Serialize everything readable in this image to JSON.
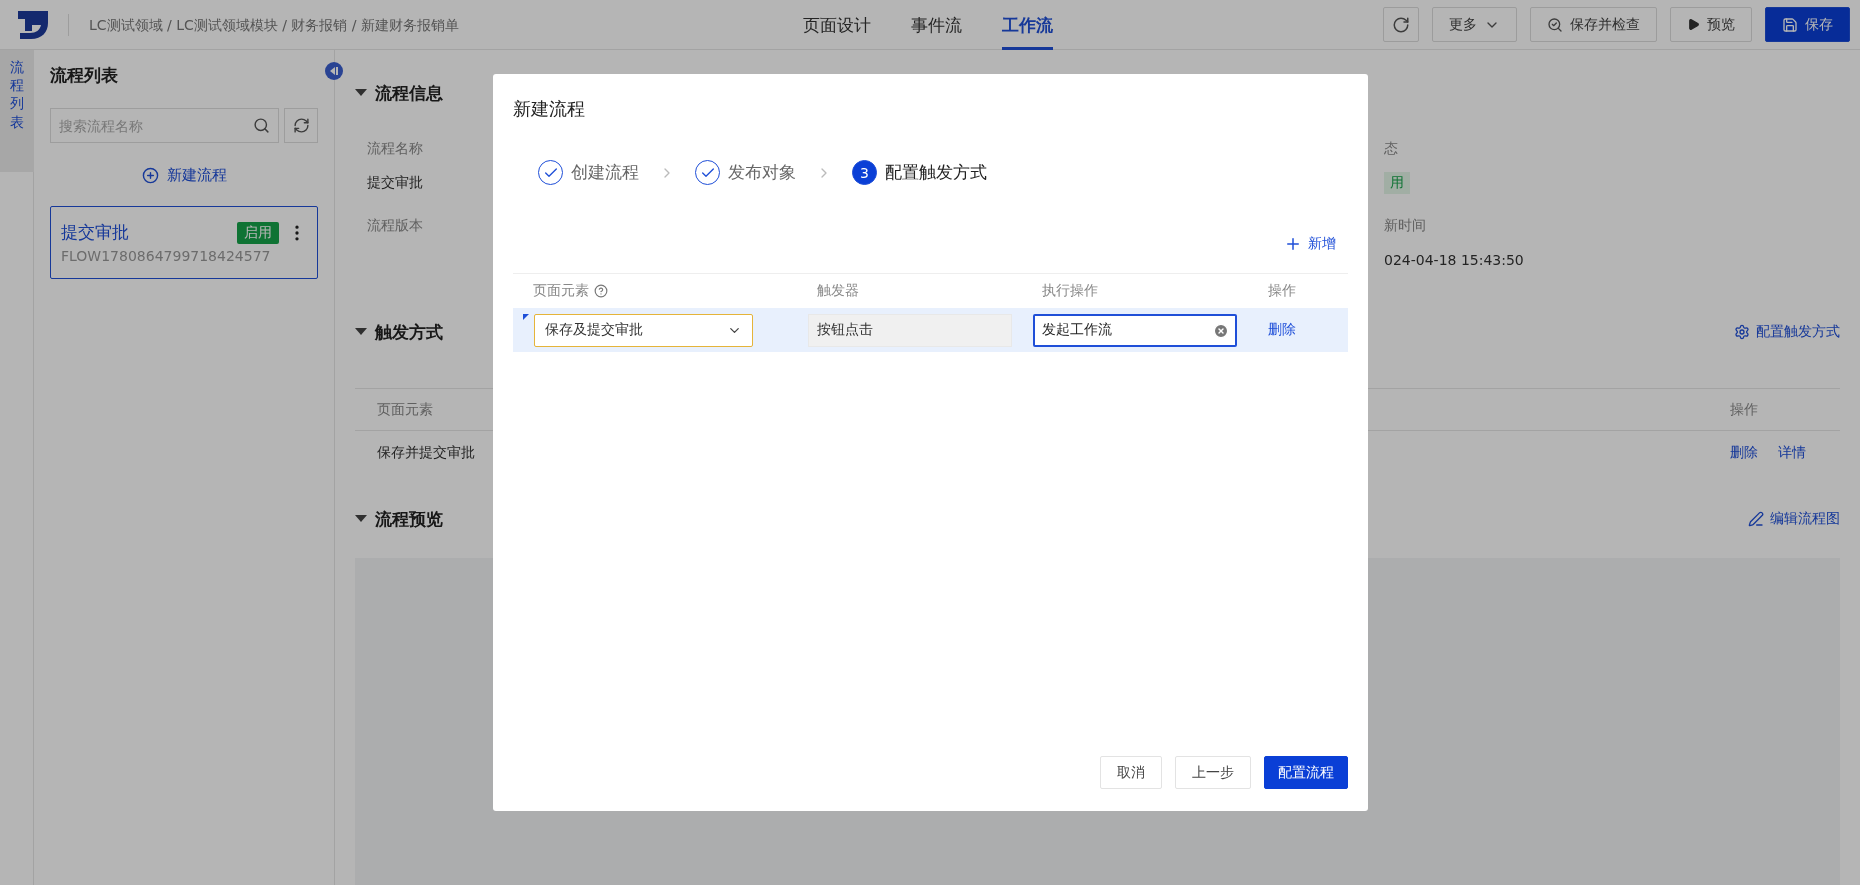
{
  "header": {
    "breadcrumb": "LC测试领域 / LC测试领域模块 / 财务报销 / 新建财务报销单",
    "tabs": [
      {
        "label": "页面设计",
        "selected": false
      },
      {
        "label": "事件流",
        "selected": false
      },
      {
        "label": "工作流",
        "selected": true
      }
    ],
    "buttons": [
      {
        "kind": "refresh"
      },
      {
        "kind": "dropdown",
        "label": "更多"
      },
      {
        "kind": "check",
        "label": "保存并检查"
      },
      {
        "kind": "play",
        "label": "预览"
      },
      {
        "kind": "save",
        "label": "保存"
      }
    ]
  },
  "side_tab": {
    "label": "流程列表",
    "selected": true
  },
  "sidebar": {
    "title": "流程列表",
    "search": {
      "placeholder": "搜索流程名称"
    },
    "new_button": "新建流程",
    "flows": [
      {
        "name": "提交审批",
        "code": "FLOW1780864799718424577",
        "status": "启用",
        "selected": true
      }
    ]
  },
  "flow_info": {
    "title": "流程信息",
    "expanded": true,
    "fields": [
      {
        "label": "流程名称",
        "value": "提交审批"
      },
      {
        "label": "流程版本"
      }
    ],
    "fields_right": [
      {
        "label": "态",
        "value": "用",
        "kind": "tag"
      },
      {
        "label": "新时间",
        "value": "024-04-18 15:43:50",
        "kind": "text"
      }
    ]
  },
  "trigger": {
    "title": "触发方式",
    "expanded": true,
    "action": "配置触发方式",
    "columns": [
      "页面元素",
      "操作"
    ],
    "rows": [
      {
        "element": "保存并提交审批",
        "actions": [
          "删除",
          "详情"
        ]
      }
    ]
  },
  "preview": {
    "title": "流程预览",
    "expanded": true,
    "action": "编辑流程图"
  },
  "modal": {
    "title": "新建流程",
    "steps": [
      {
        "label": "创建流程",
        "kind": "done"
      },
      {
        "label": "发布对象",
        "kind": "done"
      },
      {
        "number": "3",
        "label": "配置触发方式",
        "kind": "current"
      }
    ],
    "add": "新增",
    "columns": [
      "页面元素",
      "触发器",
      "执行操作",
      "操作"
    ],
    "rows": [
      {
        "element": "保存及提交审批",
        "trigger": "按钮点击",
        "action": "发起工作流",
        "delete": "删除",
        "modified": true
      }
    ],
    "buttons": [
      {
        "label": "取消",
        "kind": "default"
      },
      {
        "label": "上一步",
        "kind": "default"
      },
      {
        "label": "配置流程",
        "kind": "primary"
      }
    ]
  }
}
